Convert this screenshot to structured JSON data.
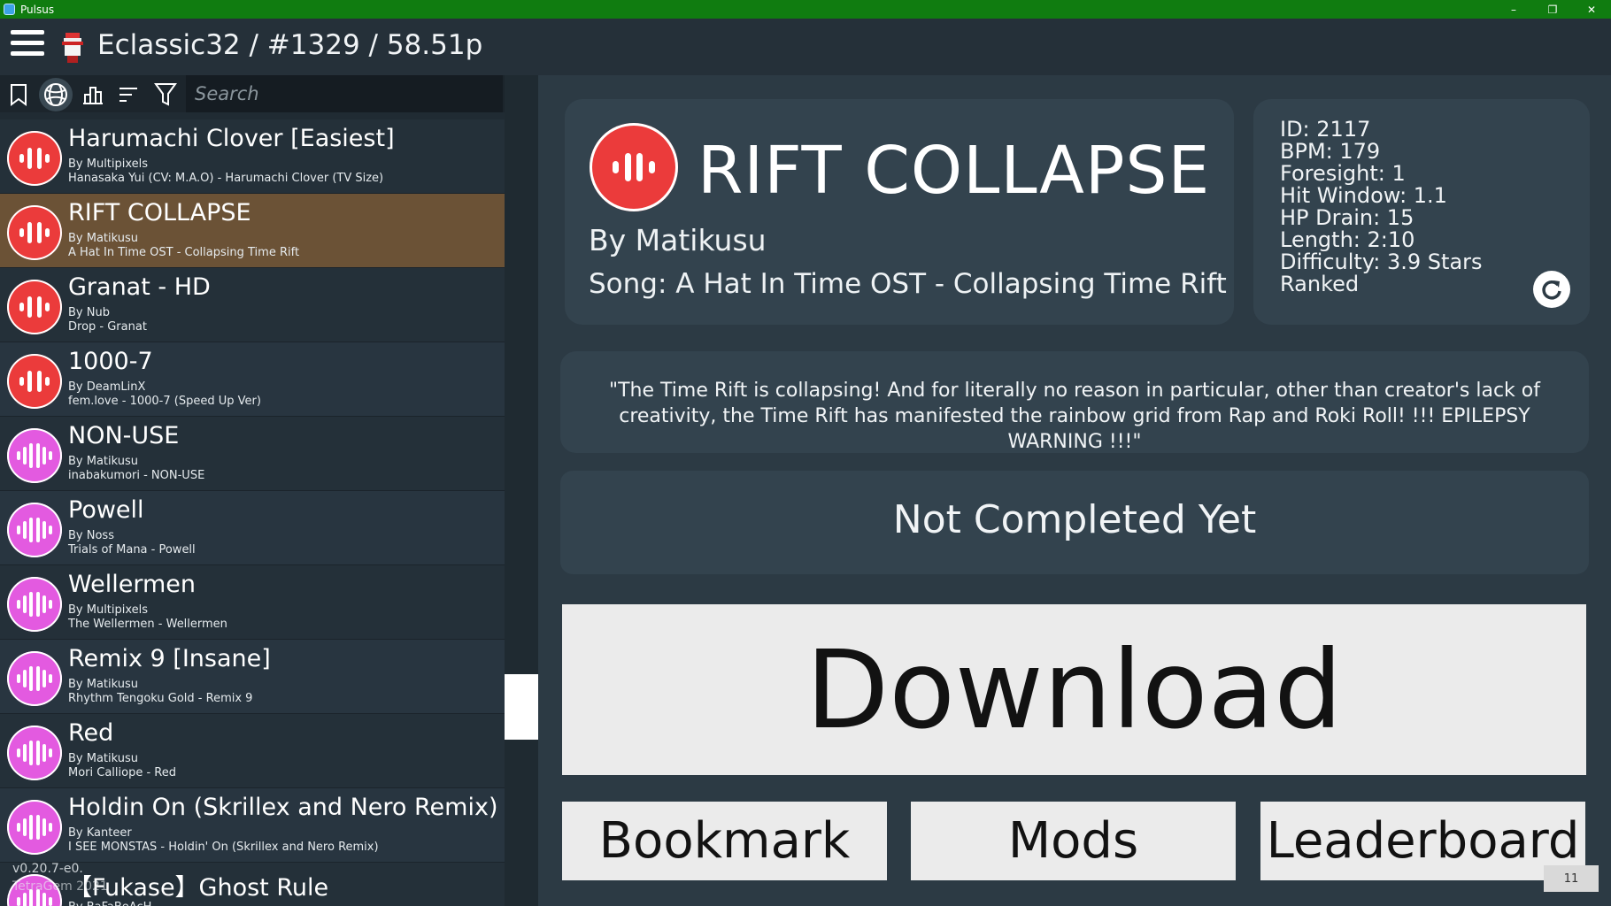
{
  "window": {
    "app_name": "Pulsus",
    "minimize": "–",
    "restore": "❐",
    "close": "✕"
  },
  "header": {
    "user_title": "Eclassic32 / #1329 / 58.51p"
  },
  "toolbar": {
    "search_placeholder": "Search",
    "add_label": "+"
  },
  "levels": [
    {
      "title": "Harumachi Clover [Easiest]",
      "author": "By Multipixels",
      "song": "Hanasaka Yui (CV: M.A.O) - Harumachi Clover (TV Size)",
      "icon_color": "red"
    },
    {
      "title": "RIFT COLLAPSE",
      "author": "By Matikusu",
      "song": "A Hat In Time OST - Collapsing Time Rift",
      "icon_color": "red"
    },
    {
      "title": "Granat - HD",
      "author": "By Nub",
      "song": "Drop - Granat",
      "icon_color": "red"
    },
    {
      "title": "1000-7",
      "author": "By DeamLinX",
      "song": "fem.love - 1000-7 (Speed Up Ver)",
      "icon_color": "red"
    },
    {
      "title": "NON-USE",
      "author": "By Matikusu",
      "song": "inabakumori - NON-USE",
      "icon_color": "pink"
    },
    {
      "title": "Powell",
      "author": "By Noss",
      "song": "Trials of Mana - Powell",
      "icon_color": "pink"
    },
    {
      "title": "Wellermen",
      "author": "By Multipixels",
      "song": "The Wellermen - Wellermen",
      "icon_color": "pink"
    },
    {
      "title": "Remix 9 [Insane]",
      "author": "By Matikusu",
      "song": "Rhythm Tengoku Gold - Remix 9",
      "icon_color": "pink"
    },
    {
      "title": "Red",
      "author": "By Matikusu",
      "song": "Mori Calliope - Red",
      "icon_color": "pink"
    },
    {
      "title": "Holdin On (Skrillex and Nero Remix)",
      "author": "By Kanteer",
      "song": "I SEE MONSTAS - Holdin' On (Skrillex and Nero Remix)",
      "icon_color": "pink"
    },
    {
      "title": "【Fukase】Ghost Rule",
      "author": "By BaFaBeAcH",
      "song": "",
      "icon_color": "pink"
    }
  ],
  "footer": {
    "version": "v0.20.7-e0.",
    "credit": "TetraGem 2021"
  },
  "detail": {
    "title": "RIFT COLLAPSE",
    "author": "By Matikusu",
    "song": "Song: A Hat In Time OST - Collapsing Time Rift",
    "stats": {
      "id": "ID: 2117",
      "bpm": "BPM: 179",
      "foresight": "Foresight: 1",
      "hit_window": "Hit Window: 1.1",
      "hp_drain": "HP Drain: 15",
      "length": "Length: 2:10",
      "difficulty": "Difficulty: 3.9 Stars",
      "status": "Ranked"
    },
    "description": "\"The Time Rift is collapsing! And for literally no reason in particular, other than creator's lack of creativity, the Time Rift has manifested the rainbow grid from Rap and Roki Roll! !!! EPILEPSY WARNING !!!\"",
    "completion": "Not Completed Yet",
    "download_label": "Download",
    "bookmark_label": "Bookmark",
    "mods_label": "Mods",
    "leaderboard_label": "Leaderboard"
  },
  "fps": "11",
  "colors": {
    "titlebar": "#107c10",
    "selected_row": "#6b5236",
    "red_icon": "#eb3b3b",
    "pink_icon": "#e35ae0"
  }
}
